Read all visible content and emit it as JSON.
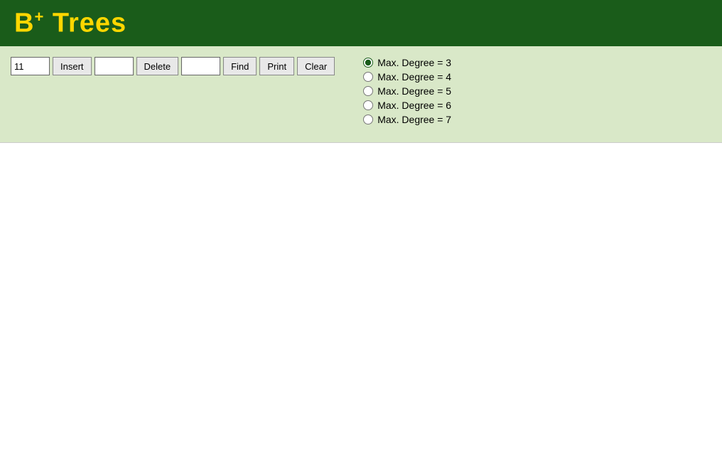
{
  "header": {
    "title_b": "B",
    "title_sup": "+",
    "title_rest": " Trees"
  },
  "controls": {
    "insert_value": "11",
    "insert_placeholder": "",
    "delete_value": "",
    "find_value": "",
    "insert_label": "Insert",
    "delete_label": "Delete",
    "find_label": "Find",
    "print_label": "Print",
    "clear_label": "Clear"
  },
  "radio_options": [
    {
      "label": "Max. Degree = 3",
      "value": "3",
      "checked": true
    },
    {
      "label": "Max. Degree = 4",
      "value": "4",
      "checked": false
    },
    {
      "label": "Max. Degree = 5",
      "value": "5",
      "checked": false
    },
    {
      "label": "Max. Degree = 6",
      "value": "6",
      "checked": false
    },
    {
      "label": "Max. Degree = 7",
      "value": "7",
      "checked": false
    }
  ],
  "colors": {
    "header_bg": "#1a5c1a",
    "title_color": "#FFD700",
    "controls_bg": "#d9e8c8"
  }
}
